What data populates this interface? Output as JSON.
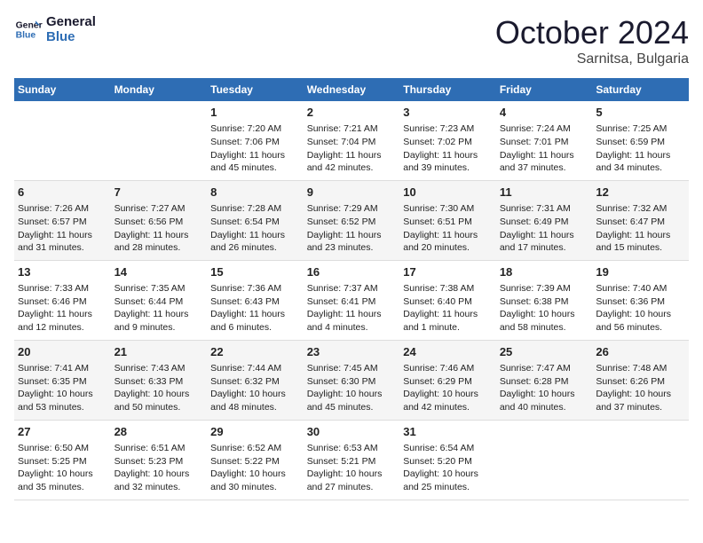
{
  "header": {
    "logo_line1": "General",
    "logo_line2": "Blue",
    "month_title": "October 2024",
    "location": "Sarnitsa, Bulgaria"
  },
  "weekdays": [
    "Sunday",
    "Monday",
    "Tuesday",
    "Wednesday",
    "Thursday",
    "Friday",
    "Saturday"
  ],
  "weeks": [
    [
      {
        "day": "",
        "info": ""
      },
      {
        "day": "",
        "info": ""
      },
      {
        "day": "1",
        "info": "Sunrise: 7:20 AM\nSunset: 7:06 PM\nDaylight: 11 hours and 45 minutes."
      },
      {
        "day": "2",
        "info": "Sunrise: 7:21 AM\nSunset: 7:04 PM\nDaylight: 11 hours and 42 minutes."
      },
      {
        "day": "3",
        "info": "Sunrise: 7:23 AM\nSunset: 7:02 PM\nDaylight: 11 hours and 39 minutes."
      },
      {
        "day": "4",
        "info": "Sunrise: 7:24 AM\nSunset: 7:01 PM\nDaylight: 11 hours and 37 minutes."
      },
      {
        "day": "5",
        "info": "Sunrise: 7:25 AM\nSunset: 6:59 PM\nDaylight: 11 hours and 34 minutes."
      }
    ],
    [
      {
        "day": "6",
        "info": "Sunrise: 7:26 AM\nSunset: 6:57 PM\nDaylight: 11 hours and 31 minutes."
      },
      {
        "day": "7",
        "info": "Sunrise: 7:27 AM\nSunset: 6:56 PM\nDaylight: 11 hours and 28 minutes."
      },
      {
        "day": "8",
        "info": "Sunrise: 7:28 AM\nSunset: 6:54 PM\nDaylight: 11 hours and 26 minutes."
      },
      {
        "day": "9",
        "info": "Sunrise: 7:29 AM\nSunset: 6:52 PM\nDaylight: 11 hours and 23 minutes."
      },
      {
        "day": "10",
        "info": "Sunrise: 7:30 AM\nSunset: 6:51 PM\nDaylight: 11 hours and 20 minutes."
      },
      {
        "day": "11",
        "info": "Sunrise: 7:31 AM\nSunset: 6:49 PM\nDaylight: 11 hours and 17 minutes."
      },
      {
        "day": "12",
        "info": "Sunrise: 7:32 AM\nSunset: 6:47 PM\nDaylight: 11 hours and 15 minutes."
      }
    ],
    [
      {
        "day": "13",
        "info": "Sunrise: 7:33 AM\nSunset: 6:46 PM\nDaylight: 11 hours and 12 minutes."
      },
      {
        "day": "14",
        "info": "Sunrise: 7:35 AM\nSunset: 6:44 PM\nDaylight: 11 hours and 9 minutes."
      },
      {
        "day": "15",
        "info": "Sunrise: 7:36 AM\nSunset: 6:43 PM\nDaylight: 11 hours and 6 minutes."
      },
      {
        "day": "16",
        "info": "Sunrise: 7:37 AM\nSunset: 6:41 PM\nDaylight: 11 hours and 4 minutes."
      },
      {
        "day": "17",
        "info": "Sunrise: 7:38 AM\nSunset: 6:40 PM\nDaylight: 11 hours and 1 minute."
      },
      {
        "day": "18",
        "info": "Sunrise: 7:39 AM\nSunset: 6:38 PM\nDaylight: 10 hours and 58 minutes."
      },
      {
        "day": "19",
        "info": "Sunrise: 7:40 AM\nSunset: 6:36 PM\nDaylight: 10 hours and 56 minutes."
      }
    ],
    [
      {
        "day": "20",
        "info": "Sunrise: 7:41 AM\nSunset: 6:35 PM\nDaylight: 10 hours and 53 minutes."
      },
      {
        "day": "21",
        "info": "Sunrise: 7:43 AM\nSunset: 6:33 PM\nDaylight: 10 hours and 50 minutes."
      },
      {
        "day": "22",
        "info": "Sunrise: 7:44 AM\nSunset: 6:32 PM\nDaylight: 10 hours and 48 minutes."
      },
      {
        "day": "23",
        "info": "Sunrise: 7:45 AM\nSunset: 6:30 PM\nDaylight: 10 hours and 45 minutes."
      },
      {
        "day": "24",
        "info": "Sunrise: 7:46 AM\nSunset: 6:29 PM\nDaylight: 10 hours and 42 minutes."
      },
      {
        "day": "25",
        "info": "Sunrise: 7:47 AM\nSunset: 6:28 PM\nDaylight: 10 hours and 40 minutes."
      },
      {
        "day": "26",
        "info": "Sunrise: 7:48 AM\nSunset: 6:26 PM\nDaylight: 10 hours and 37 minutes."
      }
    ],
    [
      {
        "day": "27",
        "info": "Sunrise: 6:50 AM\nSunset: 5:25 PM\nDaylight: 10 hours and 35 minutes."
      },
      {
        "day": "28",
        "info": "Sunrise: 6:51 AM\nSunset: 5:23 PM\nDaylight: 10 hours and 32 minutes."
      },
      {
        "day": "29",
        "info": "Sunrise: 6:52 AM\nSunset: 5:22 PM\nDaylight: 10 hours and 30 minutes."
      },
      {
        "day": "30",
        "info": "Sunrise: 6:53 AM\nSunset: 5:21 PM\nDaylight: 10 hours and 27 minutes."
      },
      {
        "day": "31",
        "info": "Sunrise: 6:54 AM\nSunset: 5:20 PM\nDaylight: 10 hours and 25 minutes."
      },
      {
        "day": "",
        "info": ""
      },
      {
        "day": "",
        "info": ""
      }
    ]
  ]
}
